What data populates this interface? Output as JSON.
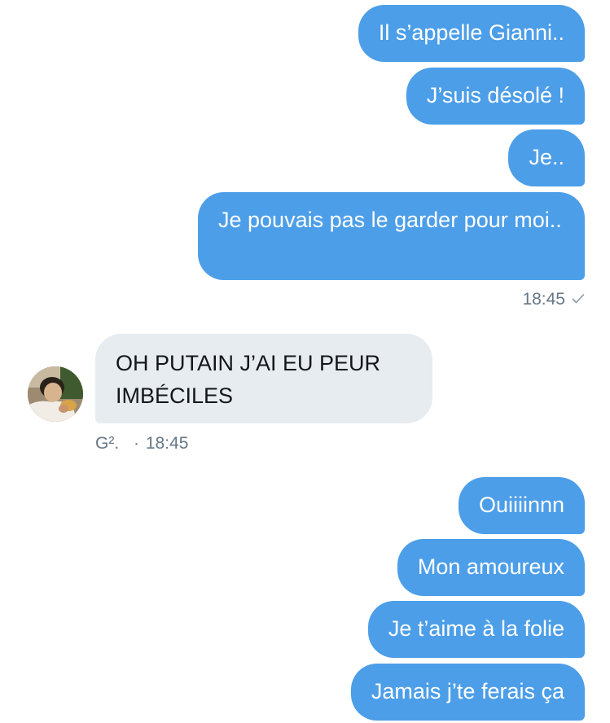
{
  "thread": {
    "group1": [
      {
        "text": "Il s’appelle Gianni.."
      },
      {
        "text": "J’suis désolé !"
      },
      {
        "text": "Je.."
      },
      {
        "text": "Je pouvais pas le garder pour moi.."
      }
    ],
    "group1_time": "18:45",
    "group1_status_icon": "check-icon",
    "incoming": {
      "text": "OH PUTAIN J’AI EU PEUR IMBÉCILES",
      "sender": "G².",
      "separator": "·",
      "time": "18:45"
    },
    "group2": [
      {
        "text": "Ouiiiinnn"
      },
      {
        "text": "Mon amoureux"
      },
      {
        "text": "Je t’aime à la folie"
      },
      {
        "text": "Jamais j’te ferais ça"
      }
    ]
  },
  "colors": {
    "outgoing_bubble": "#4c9ee8",
    "incoming_bubble": "#e6ecf0",
    "meta_text": "#657786"
  }
}
